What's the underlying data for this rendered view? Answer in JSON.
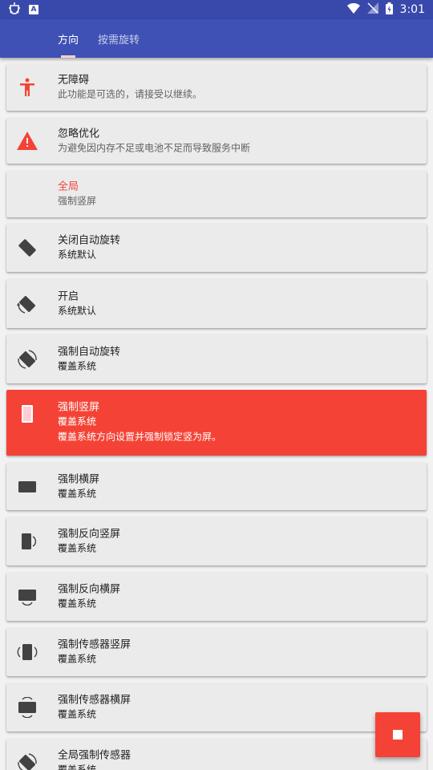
{
  "status": {
    "time": "3:01",
    "icons": [
      "bug-icon",
      "text-a-icon",
      "wifi-icon",
      "no-signal-icon",
      "battery-charging-icon"
    ]
  },
  "tabs": [
    {
      "label": "方向",
      "active": true
    },
    {
      "label": "按需旋转",
      "active": false
    }
  ],
  "colors": {
    "primary": "#3f51b5",
    "accent": "#f44336",
    "card": "#ebebeb"
  },
  "items": [
    {
      "icon": "accessibility-icon",
      "title": "无障碍",
      "subtitle": "此功能是可选的，请接受以继续。"
    },
    {
      "icon": "warning-icon",
      "title": "忽略优化",
      "subtitle": "为避免因内存不足或电池不足而导致服务中断"
    },
    {
      "icon": "",
      "title": "全局",
      "subtitle": "强制竖屏"
    },
    {
      "icon": "rotate-off-icon",
      "title": "关闭自动旋转",
      "subtitle": "系统默认"
    },
    {
      "icon": "rotate-icon",
      "title": "开启",
      "subtitle": "系统默认"
    },
    {
      "icon": "force-rotate-icon",
      "title": "强制自动旋转",
      "subtitle": "覆盖系统"
    },
    {
      "icon": "portrait-icon",
      "title": "强制竖屏",
      "subtitle": "覆盖系统",
      "description": "覆盖系统方向设置并强制锁定竖为屏。",
      "selected": true
    },
    {
      "icon": "landscape-icon",
      "title": "强制横屏",
      "subtitle": "覆盖系统"
    },
    {
      "icon": "reverse-portrait-icon",
      "title": "强制反向竖屏",
      "subtitle": "覆盖系统"
    },
    {
      "icon": "reverse-landscape-icon",
      "title": "强制反向横屏",
      "subtitle": "覆盖系统"
    },
    {
      "icon": "sensor-portrait-icon",
      "title": "强制传感器竖屏",
      "subtitle": "覆盖系统"
    },
    {
      "icon": "sensor-landscape-icon",
      "title": "强制传感器横屏",
      "subtitle": "覆盖系统"
    },
    {
      "icon": "global-sensor-icon",
      "title": "全局强制传感器",
      "subtitle": "覆盖系统"
    }
  ],
  "fab": {
    "icon": "stop-icon"
  }
}
